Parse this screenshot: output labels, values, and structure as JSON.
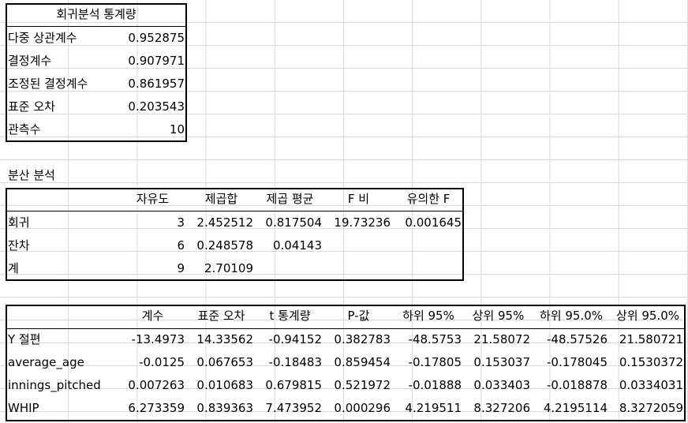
{
  "regression_stats": {
    "title": "회귀분석 통계량",
    "rows": [
      {
        "label": "다중 상관계수",
        "value": "0.952875"
      },
      {
        "label": "결정계수",
        "value": "0.907971"
      },
      {
        "label": "조정된 결정계수",
        "value": "0.861957"
      },
      {
        "label": "표준 오차",
        "value": "0.203543"
      },
      {
        "label": "관측수",
        "value": "10"
      }
    ]
  },
  "anova": {
    "title": "분산 분석",
    "headers": [
      "자유도",
      "제곱합",
      "제곱 평균",
      "F 비",
      "유의한 F"
    ],
    "rows": [
      {
        "label": "회귀",
        "values": [
          "3",
          "2.452512",
          "0.817504",
          "19.73236",
          "0.001645"
        ]
      },
      {
        "label": "잔차",
        "values": [
          "6",
          "0.248578",
          "0.04143",
          "",
          ""
        ]
      },
      {
        "label": "계",
        "values": [
          "9",
          "2.70109",
          "",
          "",
          ""
        ]
      }
    ]
  },
  "coefficients": {
    "headers": [
      "계수",
      "표준 오차",
      "t 통계량",
      "P-값",
      "하위 95%",
      "상위 95%",
      "하위 95.0%",
      "상위 95.0%"
    ],
    "rows": [
      {
        "label": "Y 절편",
        "values": [
          "-13.4973",
          "14.33562",
          "-0.94152",
          "0.382783",
          "-48.5753",
          "21.58072",
          "-48.57526",
          "21.580721"
        ]
      },
      {
        "label": "average_age",
        "values": [
          "-0.0125",
          "0.067653",
          "-0.18483",
          "0.859454",
          "-0.17805",
          "0.153037",
          "-0.178045",
          "0.1530372"
        ]
      },
      {
        "label": "innings_pitched",
        "values": [
          "0.007263",
          "0.010683",
          "0.679815",
          "0.521972",
          "-0.01888",
          "0.033403",
          "-0.018878",
          "0.0334031"
        ]
      },
      {
        "label": "WHIP",
        "values": [
          "6.273359",
          "0.839363",
          "7.473952",
          "0.000296",
          "4.219511",
          "8.327206",
          "4.2195114",
          "8.3272059"
        ]
      }
    ]
  }
}
